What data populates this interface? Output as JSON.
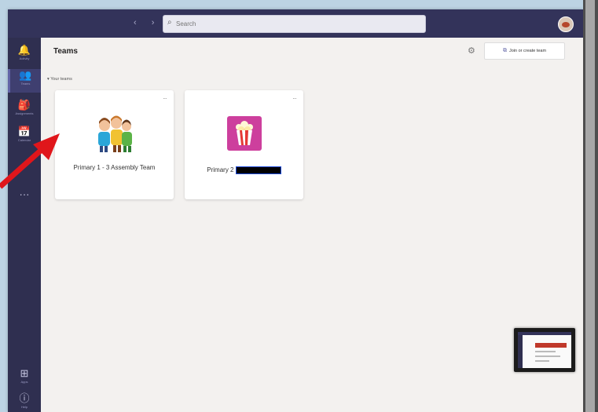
{
  "search": {
    "placeholder": "Search"
  },
  "nav": {
    "back_forward": "‹ ›"
  },
  "rail": {
    "items": [
      {
        "icon": "bell-icon",
        "glyph": "🔔",
        "label": "Activity"
      },
      {
        "icon": "teams-icon",
        "glyph": "👥",
        "label": "Teams",
        "active": true
      },
      {
        "icon": "assignments-icon",
        "glyph": "🎒",
        "label": "Assignments"
      },
      {
        "icon": "calendar-icon",
        "glyph": "📅",
        "label": "Calendar"
      },
      {
        "icon": "more-icon",
        "glyph": "···",
        "label": ""
      }
    ],
    "bottom": [
      {
        "icon": "apps-icon",
        "glyph": "⊞",
        "label": "Apps"
      },
      {
        "icon": "help-icon",
        "glyph": "ⓘ",
        "label": "Help"
      }
    ]
  },
  "main": {
    "title": "Teams",
    "join_button": "Join or create team",
    "section_label": "Your teams"
  },
  "teams": [
    {
      "name": "Primary 1 - 3 Assembly Team"
    },
    {
      "name": "Primary 2"
    }
  ],
  "colors": {
    "topbar": "#33335a",
    "rail": "#2f2f50",
    "accent": "#6264a7",
    "team_tile": "#cd3f9d",
    "arrow": "#e0161b"
  }
}
